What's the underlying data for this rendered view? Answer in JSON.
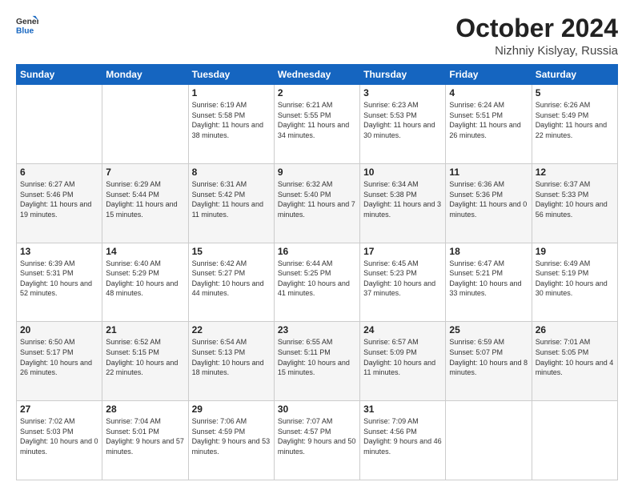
{
  "header": {
    "logo_general": "General",
    "logo_blue": "Blue",
    "month": "October 2024",
    "location": "Nizhniy Kislyay, Russia"
  },
  "days_of_week": [
    "Sunday",
    "Monday",
    "Tuesday",
    "Wednesday",
    "Thursday",
    "Friday",
    "Saturday"
  ],
  "weeks": [
    [
      {
        "day": "",
        "sunrise": "",
        "sunset": "",
        "daylight": ""
      },
      {
        "day": "",
        "sunrise": "",
        "sunset": "",
        "daylight": ""
      },
      {
        "day": "1",
        "sunrise": "Sunrise: 6:19 AM",
        "sunset": "Sunset: 5:58 PM",
        "daylight": "Daylight: 11 hours and 38 minutes."
      },
      {
        "day": "2",
        "sunrise": "Sunrise: 6:21 AM",
        "sunset": "Sunset: 5:55 PM",
        "daylight": "Daylight: 11 hours and 34 minutes."
      },
      {
        "day": "3",
        "sunrise": "Sunrise: 6:23 AM",
        "sunset": "Sunset: 5:53 PM",
        "daylight": "Daylight: 11 hours and 30 minutes."
      },
      {
        "day": "4",
        "sunrise": "Sunrise: 6:24 AM",
        "sunset": "Sunset: 5:51 PM",
        "daylight": "Daylight: 11 hours and 26 minutes."
      },
      {
        "day": "5",
        "sunrise": "Sunrise: 6:26 AM",
        "sunset": "Sunset: 5:49 PM",
        "daylight": "Daylight: 11 hours and 22 minutes."
      }
    ],
    [
      {
        "day": "6",
        "sunrise": "Sunrise: 6:27 AM",
        "sunset": "Sunset: 5:46 PM",
        "daylight": "Daylight: 11 hours and 19 minutes."
      },
      {
        "day": "7",
        "sunrise": "Sunrise: 6:29 AM",
        "sunset": "Sunset: 5:44 PM",
        "daylight": "Daylight: 11 hours and 15 minutes."
      },
      {
        "day": "8",
        "sunrise": "Sunrise: 6:31 AM",
        "sunset": "Sunset: 5:42 PM",
        "daylight": "Daylight: 11 hours and 11 minutes."
      },
      {
        "day": "9",
        "sunrise": "Sunrise: 6:32 AM",
        "sunset": "Sunset: 5:40 PM",
        "daylight": "Daylight: 11 hours and 7 minutes."
      },
      {
        "day": "10",
        "sunrise": "Sunrise: 6:34 AM",
        "sunset": "Sunset: 5:38 PM",
        "daylight": "Daylight: 11 hours and 3 minutes."
      },
      {
        "day": "11",
        "sunrise": "Sunrise: 6:36 AM",
        "sunset": "Sunset: 5:36 PM",
        "daylight": "Daylight: 11 hours and 0 minutes."
      },
      {
        "day": "12",
        "sunrise": "Sunrise: 6:37 AM",
        "sunset": "Sunset: 5:33 PM",
        "daylight": "Daylight: 10 hours and 56 minutes."
      }
    ],
    [
      {
        "day": "13",
        "sunrise": "Sunrise: 6:39 AM",
        "sunset": "Sunset: 5:31 PM",
        "daylight": "Daylight: 10 hours and 52 minutes."
      },
      {
        "day": "14",
        "sunrise": "Sunrise: 6:40 AM",
        "sunset": "Sunset: 5:29 PM",
        "daylight": "Daylight: 10 hours and 48 minutes."
      },
      {
        "day": "15",
        "sunrise": "Sunrise: 6:42 AM",
        "sunset": "Sunset: 5:27 PM",
        "daylight": "Daylight: 10 hours and 44 minutes."
      },
      {
        "day": "16",
        "sunrise": "Sunrise: 6:44 AM",
        "sunset": "Sunset: 5:25 PM",
        "daylight": "Daylight: 10 hours and 41 minutes."
      },
      {
        "day": "17",
        "sunrise": "Sunrise: 6:45 AM",
        "sunset": "Sunset: 5:23 PM",
        "daylight": "Daylight: 10 hours and 37 minutes."
      },
      {
        "day": "18",
        "sunrise": "Sunrise: 6:47 AM",
        "sunset": "Sunset: 5:21 PM",
        "daylight": "Daylight: 10 hours and 33 minutes."
      },
      {
        "day": "19",
        "sunrise": "Sunrise: 6:49 AM",
        "sunset": "Sunset: 5:19 PM",
        "daylight": "Daylight: 10 hours and 30 minutes."
      }
    ],
    [
      {
        "day": "20",
        "sunrise": "Sunrise: 6:50 AM",
        "sunset": "Sunset: 5:17 PM",
        "daylight": "Daylight: 10 hours and 26 minutes."
      },
      {
        "day": "21",
        "sunrise": "Sunrise: 6:52 AM",
        "sunset": "Sunset: 5:15 PM",
        "daylight": "Daylight: 10 hours and 22 minutes."
      },
      {
        "day": "22",
        "sunrise": "Sunrise: 6:54 AM",
        "sunset": "Sunset: 5:13 PM",
        "daylight": "Daylight: 10 hours and 18 minutes."
      },
      {
        "day": "23",
        "sunrise": "Sunrise: 6:55 AM",
        "sunset": "Sunset: 5:11 PM",
        "daylight": "Daylight: 10 hours and 15 minutes."
      },
      {
        "day": "24",
        "sunrise": "Sunrise: 6:57 AM",
        "sunset": "Sunset: 5:09 PM",
        "daylight": "Daylight: 10 hours and 11 minutes."
      },
      {
        "day": "25",
        "sunrise": "Sunrise: 6:59 AM",
        "sunset": "Sunset: 5:07 PM",
        "daylight": "Daylight: 10 hours and 8 minutes."
      },
      {
        "day": "26",
        "sunrise": "Sunrise: 7:01 AM",
        "sunset": "Sunset: 5:05 PM",
        "daylight": "Daylight: 10 hours and 4 minutes."
      }
    ],
    [
      {
        "day": "27",
        "sunrise": "Sunrise: 7:02 AM",
        "sunset": "Sunset: 5:03 PM",
        "daylight": "Daylight: 10 hours and 0 minutes."
      },
      {
        "day": "28",
        "sunrise": "Sunrise: 7:04 AM",
        "sunset": "Sunset: 5:01 PM",
        "daylight": "Daylight: 9 hours and 57 minutes."
      },
      {
        "day": "29",
        "sunrise": "Sunrise: 7:06 AM",
        "sunset": "Sunset: 4:59 PM",
        "daylight": "Daylight: 9 hours and 53 minutes."
      },
      {
        "day": "30",
        "sunrise": "Sunrise: 7:07 AM",
        "sunset": "Sunset: 4:57 PM",
        "daylight": "Daylight: 9 hours and 50 minutes."
      },
      {
        "day": "31",
        "sunrise": "Sunrise: 7:09 AM",
        "sunset": "Sunset: 4:56 PM",
        "daylight": "Daylight: 9 hours and 46 minutes."
      },
      {
        "day": "",
        "sunrise": "",
        "sunset": "",
        "daylight": ""
      },
      {
        "day": "",
        "sunrise": "",
        "sunset": "",
        "daylight": ""
      }
    ]
  ]
}
